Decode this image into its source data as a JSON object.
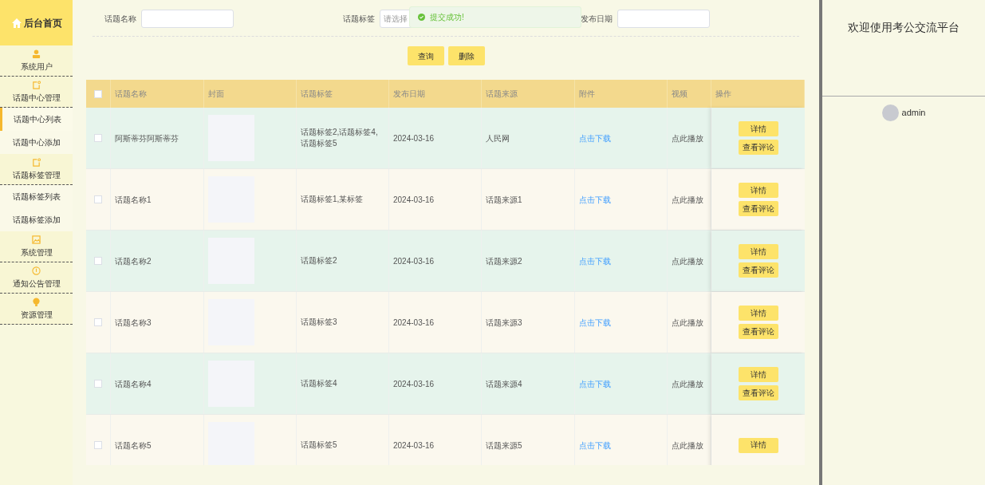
{
  "sidebar": {
    "brand": "后台首页",
    "items": [
      {
        "kind": "group",
        "label": "系统用户",
        "selected": false
      },
      {
        "kind": "group",
        "label": "话题中心管理",
        "selected": false
      },
      {
        "kind": "sub",
        "label": "话题中心列表",
        "selected": true
      },
      {
        "kind": "sub",
        "label": "话题中心添加",
        "selected": false
      },
      {
        "kind": "group",
        "label": "话题标签管理",
        "selected": false
      },
      {
        "kind": "sub",
        "label": "话题标签列表",
        "selected": false
      },
      {
        "kind": "sub",
        "label": "话题标签添加",
        "selected": false
      },
      {
        "kind": "group",
        "label": "系统管理",
        "selected": false
      },
      {
        "kind": "group",
        "label": "通知公告管理",
        "selected": false
      },
      {
        "kind": "group",
        "label": "资源管理",
        "selected": false
      }
    ]
  },
  "toast": {
    "text": "提交成功!"
  },
  "filters": [
    {
      "kind": "input",
      "label": "话题名称"
    },
    {
      "kind": "select",
      "label": "话题标签",
      "placeholder": "请选择"
    },
    {
      "kind": "input",
      "label": "发布日期"
    }
  ],
  "filter_buttons": [
    "查询",
    "删除"
  ],
  "table": {
    "header_checked": false,
    "columns": [
      "话题名称",
      "封面",
      "话题标签",
      "发布日期",
      "话题来源",
      "附件",
      "视频",
      "操作"
    ],
    "rows": [
      {
        "checked": false,
        "name": "阿斯蒂芬阿斯蒂芬",
        "tags": "话题标签2,话题标签4,话题标签5",
        "date": "2024-03-16",
        "source": "人民网",
        "attachment": "点击下载",
        "video": "点此播放",
        "actions": [
          "详情",
          "查看评论"
        ]
      },
      {
        "checked": false,
        "name": "话题名称1",
        "tags": "话题标签1,某标签",
        "date": "2024-03-16",
        "source": "话题来源1",
        "attachment": "点击下载",
        "video": "点此播放",
        "actions": [
          "详情",
          "查看评论"
        ]
      },
      {
        "checked": false,
        "name": "话题名称2",
        "tags": "话题标签2",
        "date": "2024-03-16",
        "source": "话题来源2",
        "attachment": "点击下载",
        "video": "点此播放",
        "actions": [
          "详情",
          "查看评论"
        ]
      },
      {
        "checked": false,
        "name": "话题名称3",
        "tags": "话题标签3",
        "date": "2024-03-16",
        "source": "话题来源3",
        "attachment": "点击下载",
        "video": "点此播放",
        "actions": [
          "详情",
          "查看评论"
        ]
      },
      {
        "checked": false,
        "name": "话题名称4",
        "tags": "话题标签4",
        "date": "2024-03-16",
        "source": "话题来源4",
        "attachment": "点击下载",
        "video": "点此播放",
        "actions": [
          "详情",
          "查看评论"
        ]
      },
      {
        "checked": false,
        "name": "话题名称5",
        "tags": "话题标签5",
        "date": "2024-03-16",
        "source": "话题来源5",
        "attachment": "点击下载",
        "video": "点此播放",
        "actions": [
          "详情"
        ]
      }
    ]
  },
  "right_panel": {
    "welcome": "欢迎使用考公交流平台",
    "user": "admin"
  }
}
